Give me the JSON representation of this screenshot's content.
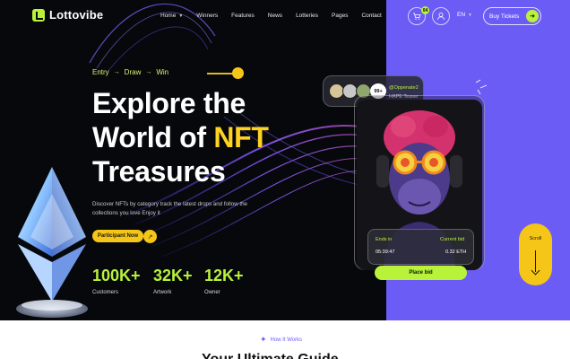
{
  "brand": {
    "name": "Lottovibe",
    "accent": "#b8f33a",
    "yellow": "#f5c518",
    "purple": "#6c5cf6"
  },
  "nav": {
    "items": [
      {
        "label": "Home",
        "has_dropdown": true
      },
      {
        "label": "Winners",
        "has_dropdown": false
      },
      {
        "label": "Features",
        "has_dropdown": false
      },
      {
        "label": "News",
        "has_dropdown": false
      },
      {
        "label": "Lotteries",
        "has_dropdown": false
      },
      {
        "label": "Pages",
        "has_dropdown": false
      },
      {
        "label": "Contact",
        "has_dropdown": false
      }
    ]
  },
  "header": {
    "cart_badge": "04",
    "language": "EN",
    "buy_label": "Buy Tickets",
    "icons": [
      "cart-icon",
      "user-icon",
      "arrow-right-icon"
    ]
  },
  "hero": {
    "steps": [
      "Entry",
      "Draw",
      "Win"
    ],
    "title_line1": "Explore the",
    "title_line2_prefix": "World of ",
    "title_highlight": "NFT",
    "title_line3": "Treasures",
    "description": "Discover NFTs by category  track the latest drops and follow the collections you love Enjoy it",
    "cta_label": "Participant Now",
    "stats": [
      {
        "value": "100K+",
        "label": "Customers"
      },
      {
        "value": "32K+",
        "label": "Artwork"
      },
      {
        "value": "12K+",
        "label": "Owner"
      }
    ]
  },
  "collectors": {
    "count": "99+",
    "handle": "@Oppenate2",
    "name": "HAPE Teaser"
  },
  "nft_card": {
    "ends_in_label": "Ends in",
    "ends_in_value": "05:39:47",
    "current_bid_label": "Current bid",
    "current_bid_value": "0.32 ETH",
    "place_bid_label": "Place bid"
  },
  "scroll": {
    "label": "Scroll"
  },
  "section": {
    "kicker": "How It Works",
    "heading": "Your Ultimate Guide"
  }
}
